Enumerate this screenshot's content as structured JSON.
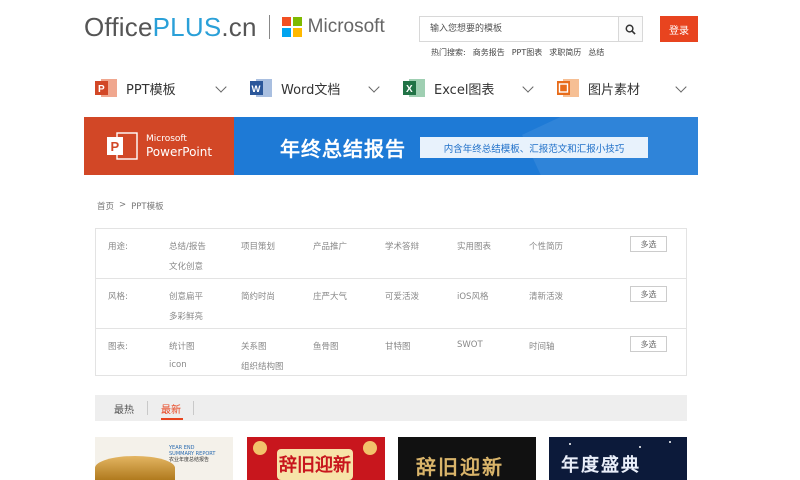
{
  "header": {
    "logo": {
      "office": "Office",
      "plus": "PLUS",
      "domain": ".cn"
    },
    "microsoft_label": "Microsoft",
    "search": {
      "placeholder": "输入您想要的模板"
    },
    "login_label": "登录",
    "hot_searches": {
      "label": "热门搜索:",
      "items": [
        "商务报告",
        "PPT图表",
        "求职简历",
        "总结"
      ]
    }
  },
  "categories": [
    {
      "label": "PPT模板",
      "icon": "powerpoint-icon",
      "color": "#d24726"
    },
    {
      "label": "Word文档",
      "icon": "word-icon",
      "color": "#2b579a"
    },
    {
      "label": "Excel图表",
      "icon": "excel-icon",
      "color": "#217346"
    },
    {
      "label": "图片素材",
      "icon": "image-icon",
      "color": "#e86c1a"
    }
  ],
  "banner": {
    "brand_line1": "Microsoft",
    "brand_line2": "PowerPoint",
    "title": "年终总结报告",
    "subtitle": "内含年终总结模板、汇报范文和汇报小技巧"
  },
  "breadcrumb": {
    "home": "首页",
    "separator": ">",
    "current": "PPT模板"
  },
  "filters": [
    {
      "label": "用途:",
      "items": [
        "总结/报告",
        "项目策划",
        "产品推广",
        "学术答辩",
        "实用图表",
        "个性简历",
        "文化创意"
      ],
      "multi_label": "多选"
    },
    {
      "label": "风格:",
      "items": [
        "创意扁平",
        "简约时尚",
        "庄严大气",
        "可爱活泼",
        "iOS风格",
        "清新活泼",
        "多彩鲜亮"
      ],
      "multi_label": "多选"
    },
    {
      "label": "图表:",
      "items": [
        "统计图",
        "关系图",
        "鱼骨图",
        "甘特图",
        "SWOT",
        "时间轴",
        "icon",
        "组织结构图"
      ],
      "multi_label": "多选"
    }
  ],
  "sort_tabs": [
    {
      "label": "最热",
      "active": false
    },
    {
      "label": "最新",
      "active": true
    }
  ],
  "thumbnails": [
    {
      "name": "harvest-report-thumb",
      "lines": [
        "YEAR END",
        "SUMMARY REPORT",
        "农业年度总结报告"
      ]
    },
    {
      "name": "spring-festival-red-thumb",
      "text": "辞旧迎新"
    },
    {
      "name": "spring-festival-black-thumb",
      "text": "辞旧迎新"
    },
    {
      "name": "annual-gala-thumb",
      "text": "年度盛典"
    }
  ],
  "colors": {
    "accent": "#e8441f",
    "link_blue": "#2aa0d8",
    "banner_blue": "#1e7ad6",
    "powerpoint_red": "#d24726"
  }
}
